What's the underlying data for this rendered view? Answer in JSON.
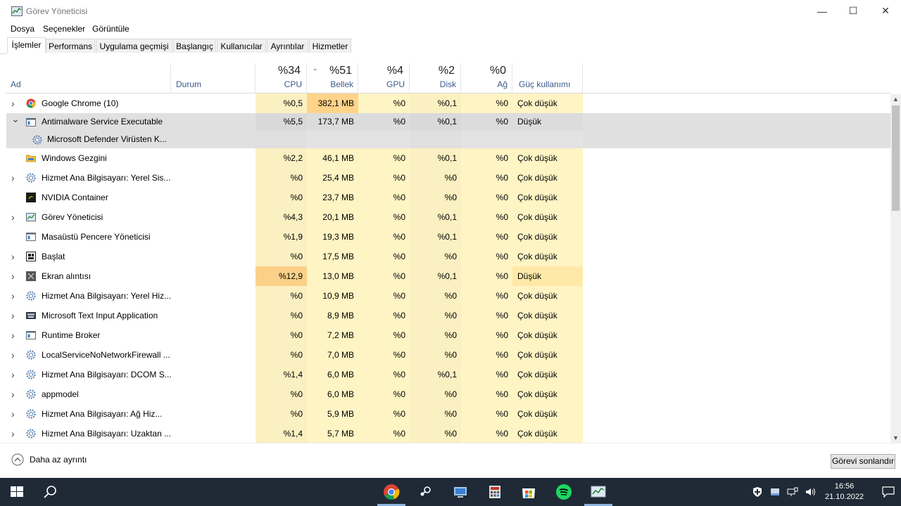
{
  "window": {
    "title": "Görev Yöneticisi",
    "minimize": "—",
    "maximize": "☐",
    "close": "✕"
  },
  "menu": [
    "Dosya",
    "Seçenekler",
    "Görüntüle"
  ],
  "tabs": [
    "İşlemler",
    "Performans",
    "Uygulama geçmişi",
    "Başlangıç",
    "Kullanıcılar",
    "Ayrıntılar",
    "Hizmetler"
  ],
  "columns": {
    "name": "Ad",
    "status": "Durum",
    "cpu": {
      "pct": "%34",
      "label": "CPU"
    },
    "mem": {
      "pct": "%51",
      "label": "Bellek"
    },
    "gpu": {
      "pct": "%4",
      "label": "GPU"
    },
    "disk": {
      "pct": "%2",
      "label": "Disk"
    },
    "net": {
      "pct": "%0",
      "label": "Ağ"
    },
    "power": "Güç kullanımı"
  },
  "rows": [
    {
      "name": "Google Chrome (10)",
      "cpu": "%0,5",
      "mem": "382,1 MB",
      "gpu": "%0",
      "disk": "%0,1",
      "net": "%0",
      "power": "Çok düşük",
      "icon": "chrome-icon",
      "expand": "right"
    },
    {
      "name": "Antimalware Service Executable",
      "cpu": "%5,5",
      "mem": "173,7 MB",
      "gpu": "%0",
      "disk": "%0,1",
      "net": "%0",
      "power": "Düşük",
      "icon": "service-icon",
      "expand": "down",
      "selected": true
    },
    {
      "name": "Microsoft Defender Virüsten K...",
      "cpu": "",
      "mem": "",
      "gpu": "",
      "disk": "",
      "net": "",
      "power": "",
      "icon": "gear-icon",
      "expand": "",
      "child": true
    },
    {
      "name": "Windows Gezgini",
      "cpu": "%2,2",
      "mem": "46,1 MB",
      "gpu": "%0",
      "disk": "%0,1",
      "net": "%0",
      "power": "Çok düşük",
      "icon": "folder-icon",
      "expand": ""
    },
    {
      "name": "Hizmet Ana Bilgisayarı: Yerel Sis...",
      "cpu": "%0",
      "mem": "25,4 MB",
      "gpu": "%0",
      "disk": "%0",
      "net": "%0",
      "power": "Çok düşük",
      "icon": "gear-icon",
      "expand": "right"
    },
    {
      "name": "NVIDIA Container",
      "cpu": "%0",
      "mem": "23,7 MB",
      "gpu": "%0",
      "disk": "%0",
      "net": "%0",
      "power": "Çok düşük",
      "icon": "nvidia-icon",
      "expand": ""
    },
    {
      "name": "Görev Yöneticisi",
      "cpu": "%4,3",
      "mem": "20,1 MB",
      "gpu": "%0",
      "disk": "%0,1",
      "net": "%0",
      "power": "Çok düşük",
      "icon": "taskmgr-icon",
      "expand": "right"
    },
    {
      "name": "Masaüstü Pencere Yöneticisi",
      "cpu": "%1,9",
      "mem": "19,3 MB",
      "gpu": "%0",
      "disk": "%0,1",
      "net": "%0",
      "power": "Çok düşük",
      "icon": "service-icon",
      "expand": ""
    },
    {
      "name": "Başlat",
      "cpu": "%0",
      "mem": "17,5 MB",
      "gpu": "%0",
      "disk": "%0",
      "net": "%0",
      "power": "Çok düşük",
      "icon": "start-icon",
      "expand": "right"
    },
    {
      "name": "Ekran alıntısı",
      "cpu": "%12,9",
      "mem": "13,0 MB",
      "gpu": "%0",
      "disk": "%0,1",
      "net": "%0",
      "power": "Düşük",
      "icon": "snip-icon",
      "expand": "right",
      "hot": true
    },
    {
      "name": "Hizmet Ana Bilgisayarı: Yerel Hiz...",
      "cpu": "%0",
      "mem": "10,9 MB",
      "gpu": "%0",
      "disk": "%0",
      "net": "%0",
      "power": "Çok düşük",
      "icon": "gear-icon",
      "expand": "right"
    },
    {
      "name": "Microsoft Text Input Application",
      "cpu": "%0",
      "mem": "8,9 MB",
      "gpu": "%0",
      "disk": "%0",
      "net": "%0",
      "power": "Çok düşük",
      "icon": "keyboard-icon",
      "expand": "right"
    },
    {
      "name": "Runtime Broker",
      "cpu": "%0",
      "mem": "7,2 MB",
      "gpu": "%0",
      "disk": "%0",
      "net": "%0",
      "power": "Çok düşük",
      "icon": "service-icon",
      "expand": "right"
    },
    {
      "name": "LocalServiceNoNetworkFirewall ...",
      "cpu": "%0",
      "mem": "7,0 MB",
      "gpu": "%0",
      "disk": "%0",
      "net": "%0",
      "power": "Çok düşük",
      "icon": "gear-icon",
      "expand": "right"
    },
    {
      "name": "Hizmet Ana Bilgisayarı: DCOM S...",
      "cpu": "%1,4",
      "mem": "6,0 MB",
      "gpu": "%0",
      "disk": "%0,1",
      "net": "%0",
      "power": "Çok düşük",
      "icon": "gear-icon",
      "expand": "right"
    },
    {
      "name": "appmodel",
      "cpu": "%0",
      "mem": "6,0 MB",
      "gpu": "%0",
      "disk": "%0",
      "net": "%0",
      "power": "Çok düşük",
      "icon": "gear-icon",
      "expand": "right"
    },
    {
      "name": "Hizmet Ana Bilgisayarı: Ağ Hiz...",
      "cpu": "%0",
      "mem": "5,9 MB",
      "gpu": "%0",
      "disk": "%0",
      "net": "%0",
      "power": "Çok düşük",
      "icon": "gear-icon",
      "expand": "right"
    },
    {
      "name": "Hizmet Ana Bilgisayarı: Uzaktan ...",
      "cpu": "%1,4",
      "mem": "5,7 MB",
      "gpu": "%0",
      "disk": "%0",
      "net": "%0",
      "power": "Çok düşük",
      "icon": "gear-icon",
      "expand": "right"
    }
  ],
  "footer": {
    "fewer_details": "Daha az ayrıntı",
    "end_task": "Görevi sonlandır"
  },
  "taskbar": {
    "apps": [
      "chrome-icon",
      "steam-icon",
      "explorer-network-icon",
      "calculator-icon",
      "store-icon",
      "spotify-icon",
      "taskmgr-icon"
    ],
    "time": "16:56",
    "date": "21.10.2022"
  },
  "colors": {
    "heat_low": "#fff4c4",
    "heat_mid": "#ffe9a8",
    "heat_high": "#ffd38a",
    "selected": "#e0e0e0"
  }
}
